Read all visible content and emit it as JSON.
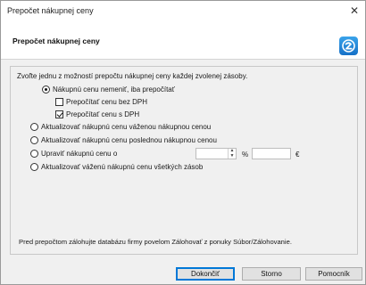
{
  "window": {
    "title": "Prepočet nákupnej ceny",
    "close_glyph": "✕"
  },
  "header": {
    "heading": "Prepočet nákupnej ceny",
    "logo_icon": "app-logo-icon",
    "accent": "#1670c7"
  },
  "content": {
    "intro": "Zvoľte jednu z možností prepočtu nákupnej ceny každej zvolenej zásoby.",
    "options": [
      {
        "label": "Nákupnú cenu nemeniť, iba prepočítať",
        "selected": true
      },
      {
        "label": "Aktualizovať nákupnú cenu váženou nákupnou cenou",
        "selected": false
      },
      {
        "label": "Aktualizovať nákupnú cenu poslednou nákupnou cenou",
        "selected": false
      },
      {
        "label": "Upraviť nákupnú cenu o",
        "selected": false
      },
      {
        "label": "Aktualizovať váženú nákupnú cenu všetkých zásob",
        "selected": false
      }
    ],
    "suboptions": [
      {
        "label": "Prepočítať cenu bez DPH",
        "checked": false
      },
      {
        "label": "Prepočítať cenu s DPH",
        "checked": true
      }
    ],
    "adjust": {
      "percent_value": "",
      "percent_unit": "%",
      "amount_value": "",
      "amount_unit": "€"
    },
    "note": "Pred prepočtom zálohujte databázu firmy povelom Zálohovať z ponuky Súbor/Zálohovanie."
  },
  "buttons": {
    "ok": "Dokončiť",
    "cancel": "Storno",
    "help": "Pomocník"
  }
}
